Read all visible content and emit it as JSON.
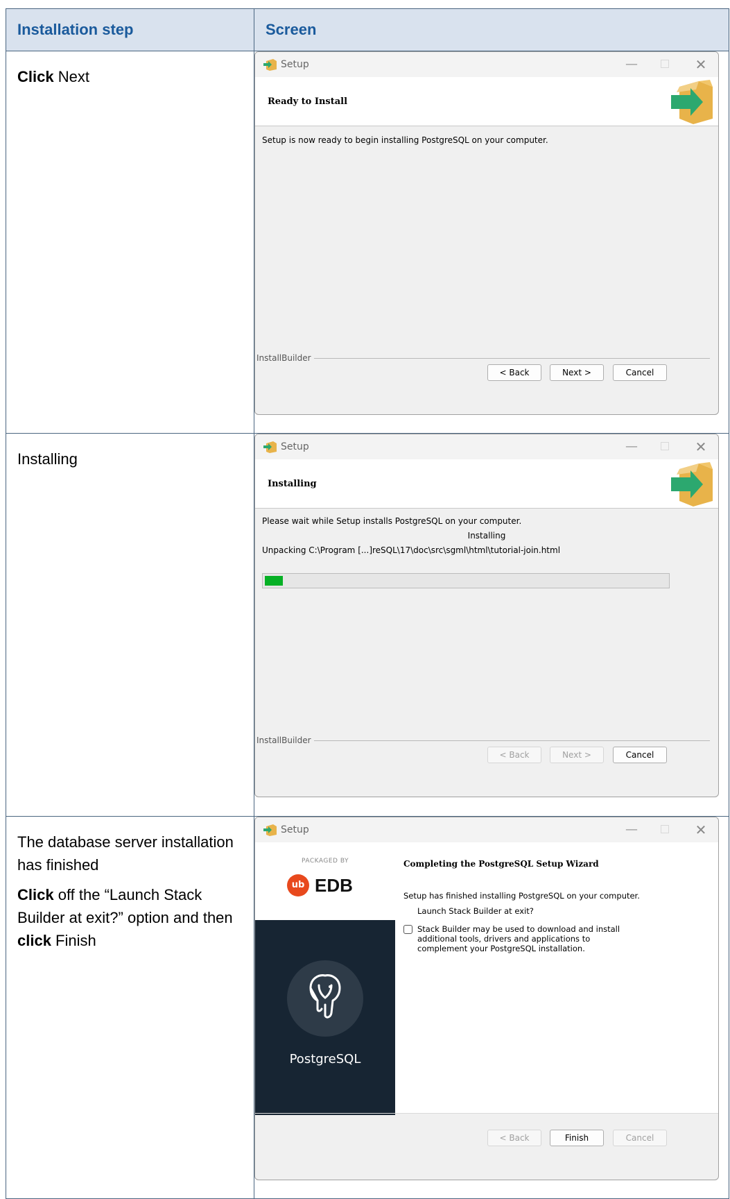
{
  "table": {
    "headers": {
      "step": "Installation step",
      "screen": "Screen"
    }
  },
  "rows": [
    {
      "step_bold": "Click",
      "step_rest": " Next",
      "window": {
        "title": "Setup",
        "banner_title": "Ready to Install",
        "body": "Setup is now ready to begin installing PostgreSQL on your computer.",
        "footer_label": "InstallBuilder",
        "back": "< Back",
        "next": "Next >",
        "cancel": "Cancel"
      }
    },
    {
      "step_text": "Installing",
      "window": {
        "title": "Setup",
        "banner_title": "Installing",
        "body": "Please wait while Setup installs PostgreSQL on your computer.",
        "status": "Installing",
        "unpacking": "Unpacking C:\\Program [...]reSQL\\17\\doc\\src\\sgml\\html\\tutorial-join.html",
        "progress_fraction": 0.045,
        "progress_color": "#06b025",
        "footer_label": "InstallBuilder",
        "back": "< Back",
        "next": "Next >",
        "cancel": "Cancel"
      }
    },
    {
      "step_line1": "The database server installation has finished",
      "step_bold1": "Click",
      "step_mid": " off the “Launch Stack Builder at exit?” option and then ",
      "step_bold2": "click",
      "step_end": " Finish",
      "window": {
        "title": "Setup",
        "packaged_by": "PACKAGED BY",
        "edb_logo": "EDB",
        "edb_mark": "ub",
        "product": "PostgreSQL",
        "heading": "Completing the PostgreSQL Setup Wizard",
        "finished": "Setup has finished installing PostgreSQL on your computer.",
        "launch": "Launch Stack Builder at exit?",
        "description": "Stack Builder may be used to download and install additional tools, drivers and applications to complement your PostgreSQL installation.",
        "checkbox_checked": false,
        "back": "< Back",
        "finish": "Finish",
        "cancel": "Cancel"
      }
    }
  ]
}
